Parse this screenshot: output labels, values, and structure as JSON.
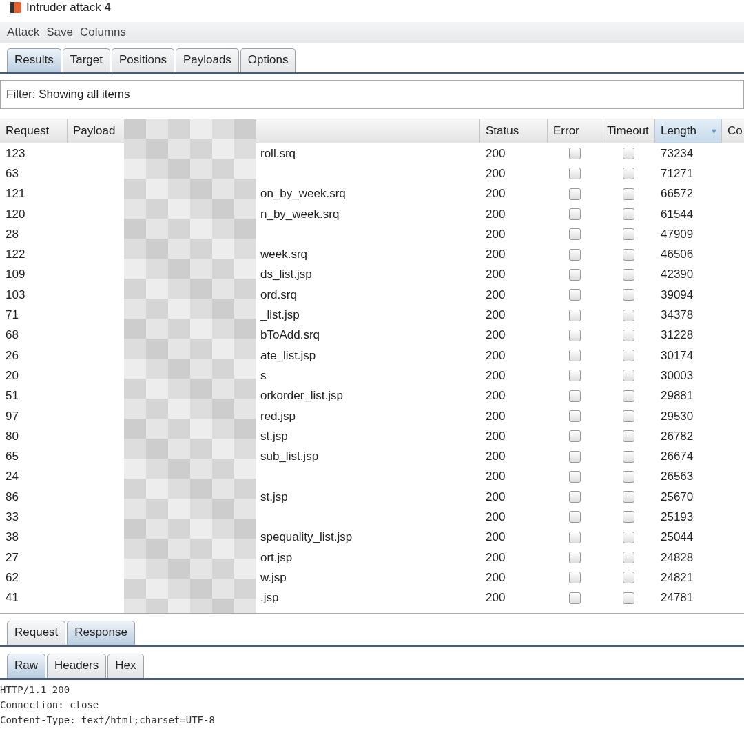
{
  "window": {
    "title": "Intruder attack 4"
  },
  "menu": [
    "Attack",
    "Save",
    "Columns"
  ],
  "tabs": [
    {
      "label": "Results",
      "selected": true
    },
    {
      "label": "Target",
      "selected": false
    },
    {
      "label": "Positions",
      "selected": false
    },
    {
      "label": "Payloads",
      "selected": false
    },
    {
      "label": "Options",
      "selected": false
    }
  ],
  "filter": "Filter: Showing all items",
  "table": {
    "columns": [
      {
        "label": "Request",
        "sorted": false
      },
      {
        "label": "Payload",
        "sorted": false
      },
      {
        "label": "Status",
        "sorted": false
      },
      {
        "label": "Error",
        "sorted": false
      },
      {
        "label": "Timeout",
        "sorted": false
      },
      {
        "label": "Length",
        "sorted": true,
        "sort_icon": "▼"
      },
      {
        "label": "Co",
        "sorted": false
      }
    ],
    "rows": [
      {
        "request": "123",
        "payload": "roll.srq",
        "status": "200",
        "error": false,
        "timeout": false,
        "length": "73234"
      },
      {
        "request": "63",
        "status": "200",
        "error": false,
        "timeout": false,
        "length": "71271"
      },
      {
        "request": "121",
        "payload": "on_by_week.srq",
        "status": "200",
        "error": false,
        "timeout": false,
        "length": "66572"
      },
      {
        "request": "120",
        "payload": "n_by_week.srq",
        "status": "200",
        "error": false,
        "timeout": false,
        "length": "61544"
      },
      {
        "request": "28",
        "status": "200",
        "error": false,
        "timeout": false,
        "length": "47909"
      },
      {
        "request": "122",
        "payload": "week.srq",
        "status": "200",
        "error": false,
        "timeout": false,
        "length": "46506"
      },
      {
        "request": "109",
        "payload": "ds_list.jsp",
        "status": "200",
        "error": false,
        "timeout": false,
        "length": "42390"
      },
      {
        "request": "103",
        "payload": "ord.srq",
        "status": "200",
        "error": false,
        "timeout": false,
        "length": "39094"
      },
      {
        "request": "71",
        "payload": "_list.jsp",
        "status": "200",
        "error": false,
        "timeout": false,
        "length": "34378"
      },
      {
        "request": "68",
        "payload": "bToAdd.srq",
        "status": "200",
        "error": false,
        "timeout": false,
        "length": "31228"
      },
      {
        "request": "26",
        "payload": "ate_list.jsp",
        "status": "200",
        "error": false,
        "timeout": false,
        "length": "30174"
      },
      {
        "request": "20",
        "payload": "s",
        "status": "200",
        "error": false,
        "timeout": false,
        "length": "30003"
      },
      {
        "request": "51",
        "payload": "orkorder_list.jsp",
        "status": "200",
        "error": false,
        "timeout": false,
        "length": "29881"
      },
      {
        "request": "97",
        "payload": "red.jsp",
        "status": "200",
        "error": false,
        "timeout": false,
        "length": "29530"
      },
      {
        "request": "80",
        "payload": "st.jsp",
        "status": "200",
        "error": false,
        "timeout": false,
        "length": "26782"
      },
      {
        "request": "65",
        "payload": "sub_list.jsp",
        "status": "200",
        "error": false,
        "timeout": false,
        "length": "26674"
      },
      {
        "request": "24",
        "status": "200",
        "error": false,
        "timeout": false,
        "length": "26563"
      },
      {
        "request": "86",
        "payload": "st.jsp",
        "status": "200",
        "error": false,
        "timeout": false,
        "length": "25670"
      },
      {
        "request": "33",
        "status": "200",
        "error": false,
        "timeout": false,
        "length": "25193"
      },
      {
        "request": "38",
        "payload": "spequality_list.jsp",
        "status": "200",
        "error": false,
        "timeout": false,
        "length": "25044"
      },
      {
        "request": "27",
        "payload": "ort.jsp",
        "status": "200",
        "error": false,
        "timeout": false,
        "length": "24828"
      },
      {
        "request": "62",
        "payload": "w.jsp",
        "status": "200",
        "error": false,
        "timeout": false,
        "length": "24821"
      },
      {
        "request": "41",
        "payload": ".jsp",
        "status": "200",
        "error": false,
        "timeout": false,
        "length": "24781"
      }
    ]
  },
  "message_tabs": [
    {
      "label": "Request",
      "selected": false
    },
    {
      "label": "Response",
      "selected": true
    }
  ],
  "view_tabs": [
    {
      "label": "Raw",
      "selected": true
    },
    {
      "label": "Headers",
      "selected": false
    },
    {
      "label": "Hex",
      "selected": false
    }
  ],
  "response_lines": [
    "HTTP/1.1 200",
    "Connection: close",
    "Content-Type: text/html;charset=UTF-8"
  ]
}
